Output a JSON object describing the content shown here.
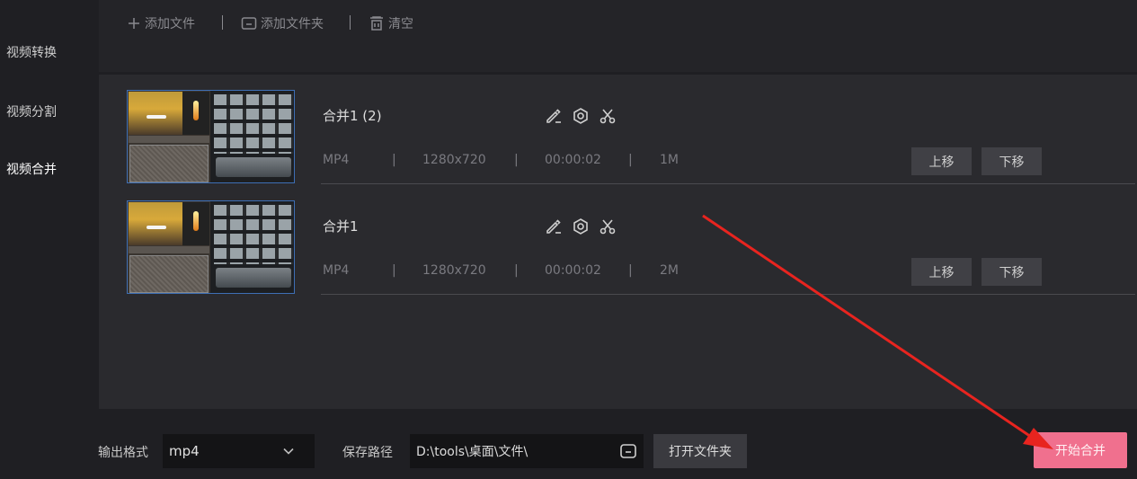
{
  "sidebar": {
    "items": [
      {
        "label": "视频转换",
        "active": false
      },
      {
        "label": "视频分割",
        "active": false
      },
      {
        "label": "视频合并",
        "active": true
      }
    ]
  },
  "toolbar": {
    "add_file": "添加文件",
    "add_folder": "添加文件夹",
    "clear": "清空"
  },
  "files": [
    {
      "name": "合并1 (2)",
      "format": "MP4",
      "resolution": "1280x720",
      "duration": "00:00:02",
      "size": "1M"
    },
    {
      "name": "合并1",
      "format": "MP4",
      "resolution": "1280x720",
      "duration": "00:00:02",
      "size": "2M"
    }
  ],
  "row_actions": {
    "move_up": "上移",
    "move_down": "下移"
  },
  "meta_separator": "|",
  "bottom": {
    "format_label": "输出格式",
    "format_value": "mp4",
    "path_label": "保存路径",
    "path_value": "D:\\tools\\桌面\\文件\\",
    "open_folder": "打开文件夹",
    "start": "开始合并"
  },
  "colors": {
    "accent": "#f0708e",
    "annotation_arrow": "#e8241f",
    "background": "#1f1f23",
    "panel": "#2a2a2e"
  }
}
